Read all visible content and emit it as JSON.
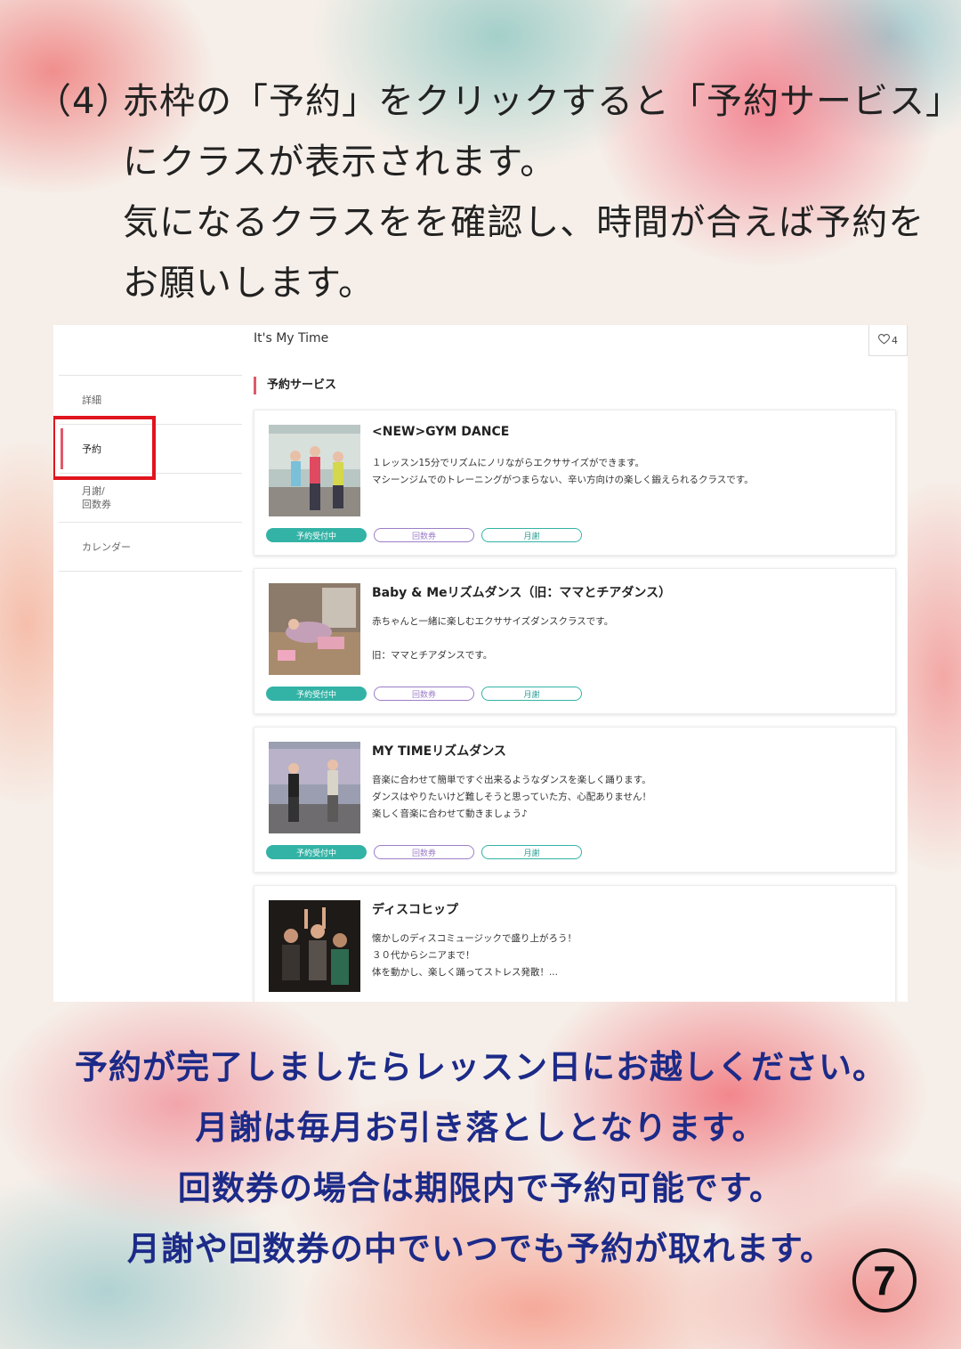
{
  "intro": {
    "number": "（4）",
    "line1": "赤枠の「予約」をクリックすると「予約サービス」",
    "line2": "にクラスが表示されます。",
    "line3": "気になるクラスをを確認し、時間が合えば予約を",
    "line4": "お願いします。"
  },
  "screenshot": {
    "shop_title": "It's My Time",
    "favorite_count": "4",
    "sidebar": [
      {
        "label": "詳細"
      },
      {
        "label": "予約"
      },
      {
        "label": "月謝/\n回数券"
      },
      {
        "label": "カレンダー"
      }
    ],
    "section_title": "予約サービス",
    "cards": [
      {
        "title": "<NEW>GYM DANCE",
        "description": "１レッスン15分でリズムにノリながらエクササイズができます。\nマシーンジムでのトレーニングがつまらない、辛い方向けの楽しく鍛えられるクラスです。",
        "tags": [
          "予約受付中",
          "回数券",
          "月謝"
        ]
      },
      {
        "title": "Baby & Meリズムダンス（旧：ママとチアダンス）",
        "description": "赤ちゃんと一緒に楽しむエクササイズダンスクラスです。\n\n旧：ママとチアダンスです。",
        "tags": [
          "予約受付中",
          "回数券",
          "月謝"
        ]
      },
      {
        "title": "MY TIMEリズムダンス",
        "description": "音楽に合わせて簡単ですぐ出来るようなダンスを楽しく踊ります。\nダンスはやりたいけど難しそうと思っていた方、心配ありません！\n楽しく音楽に合わせて動きましょう♪",
        "tags": [
          "予約受付中",
          "回数券",
          "月謝"
        ]
      },
      {
        "title": "ディスコヒップ",
        "description": "懐かしのディスコミュージックで盛り上がろう！\n３０代からシニアまで！\n体を動かし、楽しく踊ってストレス発散！...",
        "tags": []
      }
    ]
  },
  "outro": {
    "line1": "予約が完了しましたらレッスン日にお越しください。",
    "line2": "月謝は毎月お引き落としとなります。",
    "line3": "回数券の場合は期限内で予約可能です。",
    "line4": "月謝や回数券の中でいつでも予約が取れます。"
  },
  "page_number": "7",
  "colors": {
    "accent_red": "#e05a6a",
    "highlight_box": "#e0141e",
    "teal": "#33b3a6",
    "purple": "#9d7ec7",
    "outro_text": "#1c2a88"
  }
}
